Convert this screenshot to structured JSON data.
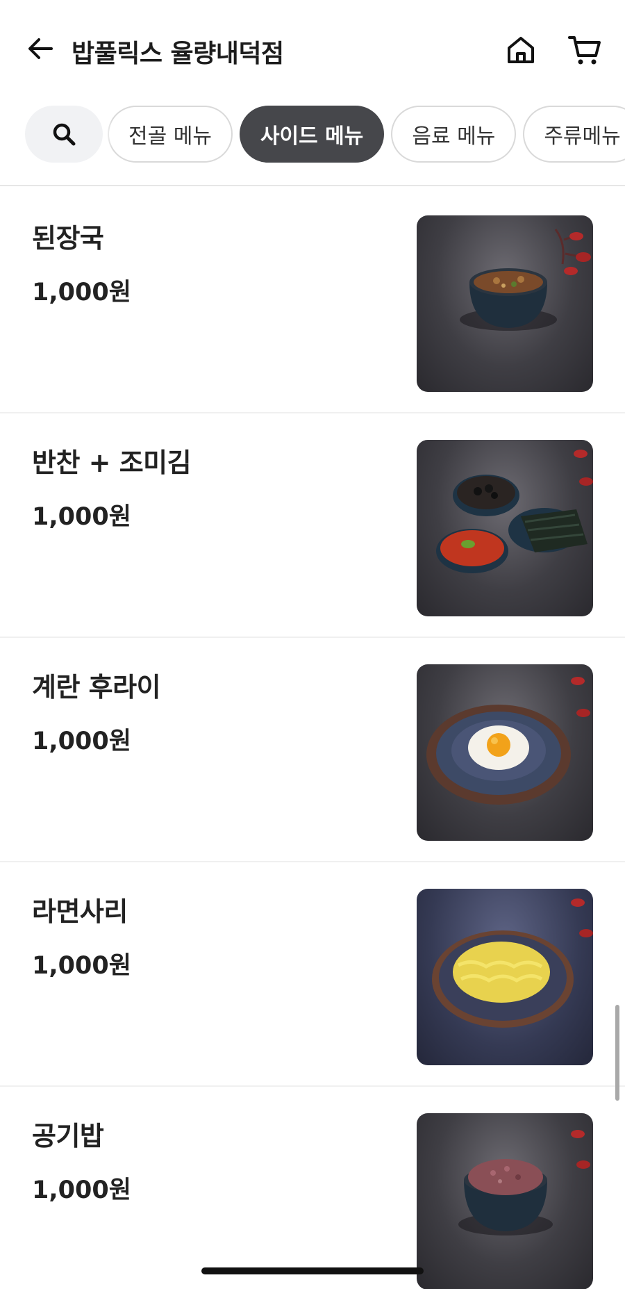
{
  "header": {
    "title": "밥풀릭스 율량내덕점",
    "back_icon": "arrow-left-icon",
    "home_icon": "home-icon",
    "cart_icon": "cart-icon"
  },
  "categories": {
    "search_icon": "search-icon",
    "tabs": [
      {
        "label": "전골 메뉴",
        "active": false
      },
      {
        "label": "사이드 메뉴",
        "active": true
      },
      {
        "label": "음료 메뉴",
        "active": false
      },
      {
        "label": "주류메뉴",
        "active": false
      }
    ]
  },
  "menu": {
    "items": [
      {
        "name": "된장국",
        "price": "1,000원",
        "image": "soybean-paste-soup"
      },
      {
        "name": "반찬 + 조미김",
        "price": "1,000원",
        "image": "side-dishes-seasoned-laver"
      },
      {
        "name": "계란 후라이",
        "price": "1,000원",
        "image": "fried-egg"
      },
      {
        "name": "라면사리",
        "price": "1,000원",
        "image": "ramen-noodles"
      },
      {
        "name": "공기밥",
        "price": "1,000원",
        "image": "bowl-of-rice"
      }
    ]
  },
  "colors": {
    "active_tab": "#46474b",
    "tab_border": "#d9d9d9",
    "search_bg": "#f1f2f4",
    "text": "#222222"
  }
}
